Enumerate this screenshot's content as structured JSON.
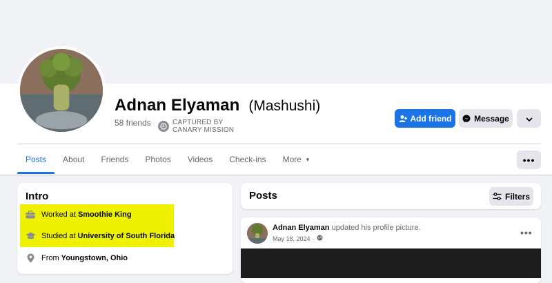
{
  "profile": {
    "name": "Adnan Elyaman",
    "nickname": "(Mashushi)",
    "friends": "58 friends",
    "captured_line1": "CAPTURED BY",
    "captured_line2": "CANARY MISSION"
  },
  "actions": {
    "add_friend": "Add friend",
    "message": "Message"
  },
  "tabs": [
    {
      "label": "Posts",
      "active": true
    },
    {
      "label": "About"
    },
    {
      "label": "Friends"
    },
    {
      "label": "Photos"
    },
    {
      "label": "Videos"
    },
    {
      "label": "Check-ins"
    },
    {
      "label": "More"
    }
  ],
  "intro": {
    "title": "Intro",
    "items": [
      {
        "icon": "briefcase-icon",
        "prefix": "Worked at",
        "value": "Smoothie King",
        "highlighted": true
      },
      {
        "icon": "graduation-cap-icon",
        "prefix": "Studied at",
        "value": "University of South Florida",
        "highlighted": true
      },
      {
        "icon": "location-pin-icon",
        "prefix": "From",
        "value": "Youngstown, Ohio",
        "highlighted": false
      }
    ]
  },
  "posts": {
    "title": "Posts",
    "filters_label": "Filters"
  },
  "post": {
    "author": "Adnan Elyaman",
    "action": "updated his profile picture.",
    "date": "May 18, 2024",
    "separator": "·"
  },
  "colors": {
    "primary": "#1b74e4",
    "highlight": "#eef200",
    "secondary_button": "#e4e6eb"
  }
}
